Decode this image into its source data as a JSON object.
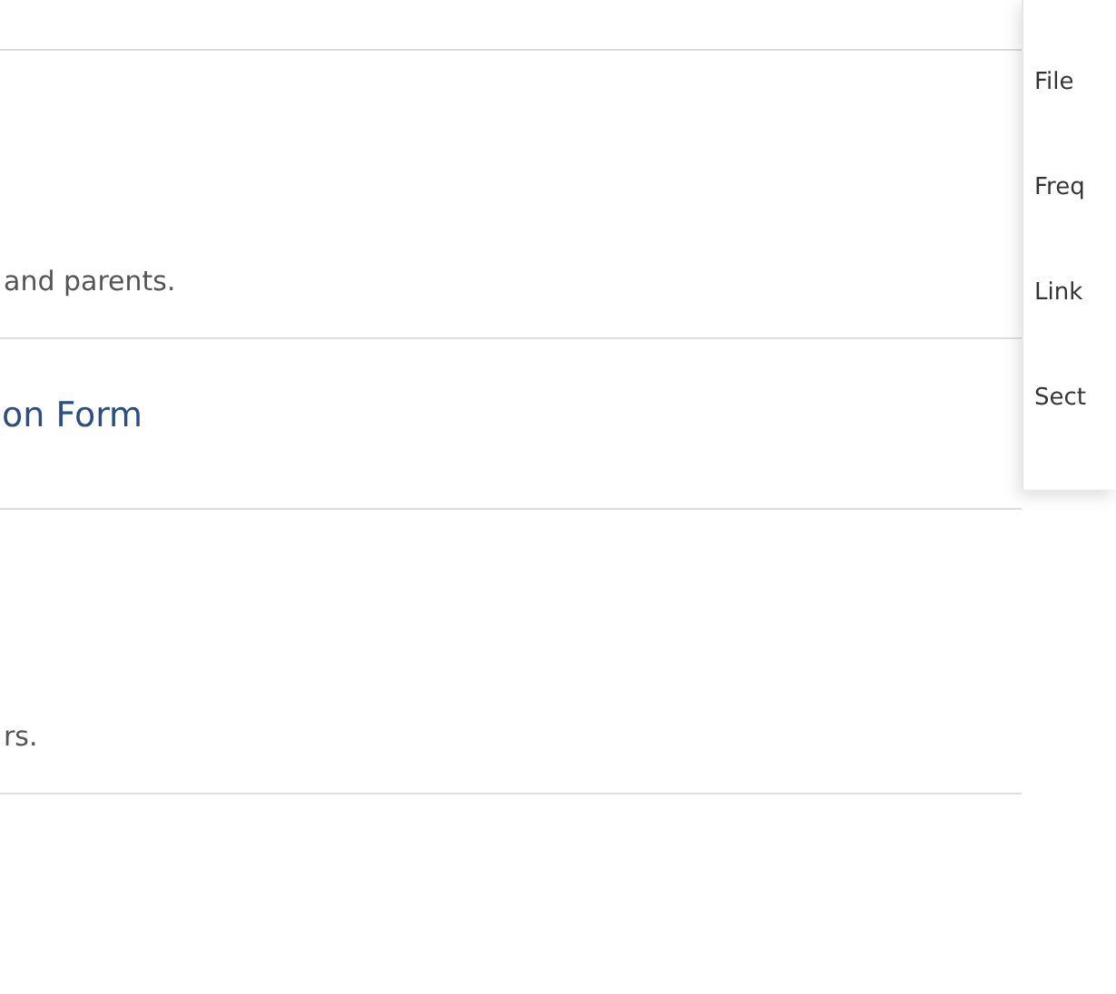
{
  "sections": [
    {
      "kind": "text",
      "text": "and parents."
    },
    {
      "kind": "heading",
      "text": "on Form"
    },
    {
      "kind": "text",
      "text": "rs."
    }
  ],
  "side_menu": {
    "items": [
      {
        "label": "File"
      },
      {
        "label": "Freq"
      },
      {
        "label": "Link"
      },
      {
        "label": "Sect"
      }
    ]
  }
}
